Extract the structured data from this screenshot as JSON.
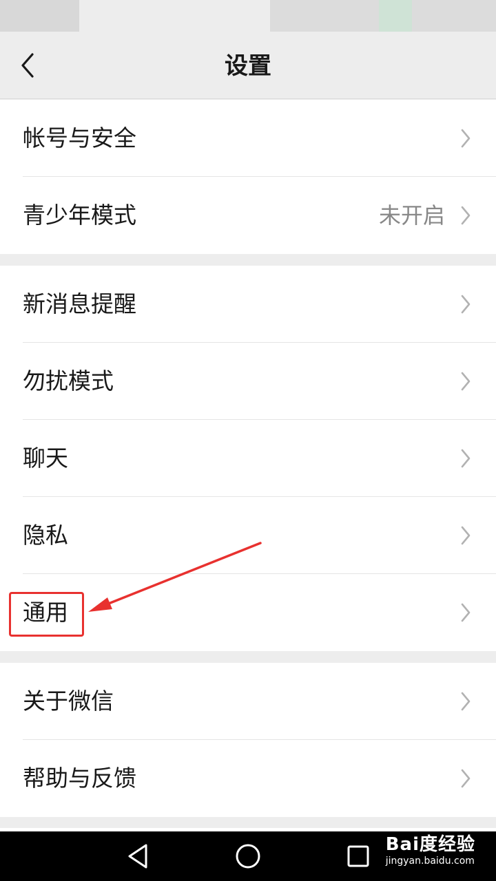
{
  "header": {
    "title": "设置"
  },
  "groups": [
    {
      "items": [
        {
          "label": "帐号与安全",
          "value": ""
        },
        {
          "label": "青少年模式",
          "value": "未开启"
        }
      ]
    },
    {
      "items": [
        {
          "label": "新消息提醒",
          "value": ""
        },
        {
          "label": "勿扰模式",
          "value": ""
        },
        {
          "label": "聊天",
          "value": ""
        },
        {
          "label": "隐私",
          "value": ""
        },
        {
          "label": "通用",
          "value": ""
        }
      ]
    },
    {
      "items": [
        {
          "label": "关于微信",
          "value": ""
        },
        {
          "label": "帮助与反馈",
          "value": ""
        }
      ]
    }
  ],
  "annotation": {
    "highlighted_item": "通用",
    "color": "#e8312f"
  },
  "system_nav": {
    "buttons": [
      "back-icon",
      "home-icon",
      "recents-icon"
    ]
  },
  "watermark": {
    "main": "Bai度经验",
    "sub": "jingyan.baidu.com"
  }
}
